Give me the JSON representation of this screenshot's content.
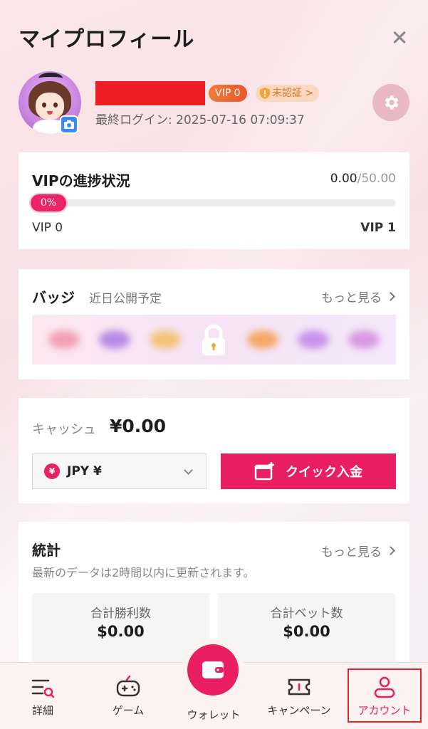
{
  "page": {
    "title": "マイプロフィール"
  },
  "profile": {
    "vip_badge": "VIP 0",
    "verification_status": "未認証 >",
    "last_login": "最終ログイン: 2025-07-16 07:09:37"
  },
  "vip_progress": {
    "title": "VIPの進捗状況",
    "current": "0.00",
    "max": "/50.00",
    "percent_label": "0%",
    "percent": 0,
    "from_level": "VIP 0",
    "to_level": "VIP 1"
  },
  "badges": {
    "title": "バッジ",
    "subtitle": "近日公開予定",
    "more": "もっと見る"
  },
  "cash": {
    "label": "キャッシュ",
    "amount": "¥0.00",
    "currency_symbol": "¥",
    "currency_selected": "JPY ¥",
    "deposit_button": "クイック入金"
  },
  "stats": {
    "title": "統計",
    "more": "もっと見る",
    "description": "最新のデータは2時間以内に更新されます。",
    "total_wins_label": "合計勝利数",
    "total_wins_value": "$0.00",
    "total_bets_label": "合計ベット数",
    "total_bets_value": "$0.00"
  },
  "nav": {
    "details": "詳細",
    "game": "ゲーム",
    "wallet": "ウォレット",
    "campaign": "キャンペーン",
    "account": "アカウント"
  },
  "colors": {
    "accent": "#ea1e63",
    "vip_orange": "#e9582a",
    "redacted": "#ee1c25"
  }
}
